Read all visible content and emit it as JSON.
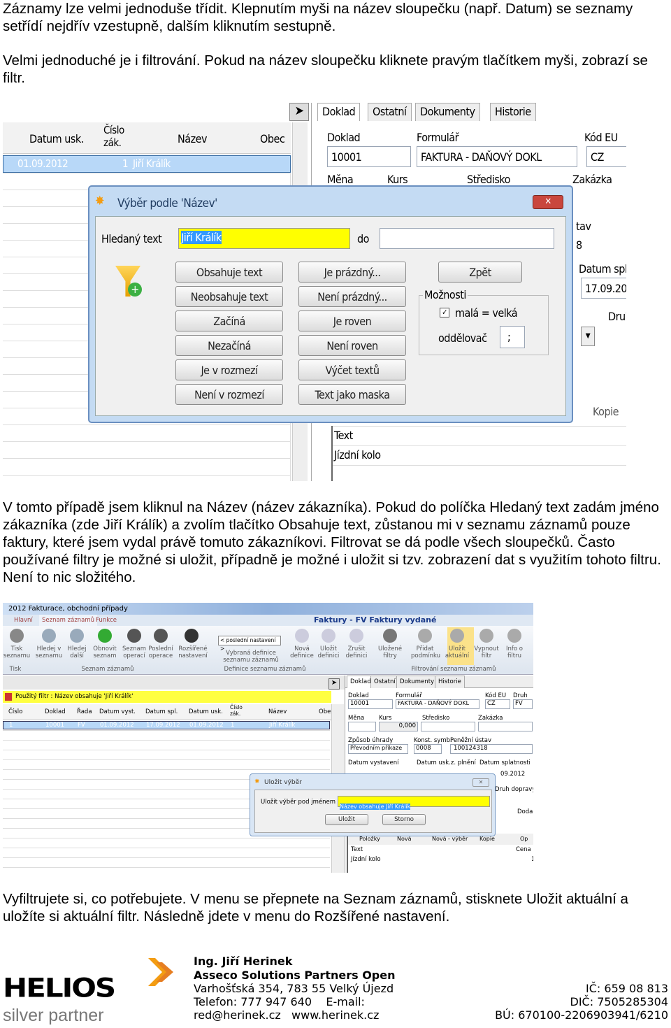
{
  "paragraphs": {
    "p1": "Záznamy lze velmi jednoduše třídit. Klepnutím myši na název sloupečku (např. Datum) se seznamy setřídí nejdřív vzestupně, dalším kliknutím sestupně.",
    "p2": "Velmi jednoduché je i filtrování. Pokud na název sloupečku kliknete pravým tlačítkem myši, zobrazí se filtr.",
    "p3": "V tomto případě jsem kliknul na Název (název zákazníka). Pokud do políčka Hledaný text zadám jméno zákazníka (zde Jiří Králík) a zvolím tlačítko Obsahuje text, zůstanou mi v seznamu záznamů pouze faktury, které jsem vydal právě tomuto zákazníkovi. Filtrovat se dá podle všech sloupečků. Často používané filtry je možné si uložit, případně je možné i uložit si tzv. zobrazení dat s využitím tohoto filtru. Není to nic složitého.",
    "p4": "Vyfiltrujete si, co potřebujete. V menu se přepnete na Seznam záznamů, stisknete Uložit aktuální a uložíte si aktuální filtr. Následně jdete v menu do Rozšířené nastavení."
  },
  "shot1": {
    "columns": [
      "Datum usk.",
      "Číslo zák.",
      "Název",
      "Obec"
    ],
    "row": [
      "01.09.2012",
      "1",
      "Jiří Králík"
    ],
    "tabs": [
      "Doklad",
      "Ostatní",
      "Dokumenty",
      "Historie"
    ],
    "fields": {
      "doklad_label": "Doklad",
      "doklad_value": "10001",
      "formular_label": "Formulář",
      "formular_value": "FAKTURA - DAŇOVÝ DOKL",
      "kod_eu_label": "Kód EU",
      "kod_eu_value": "CZ",
      "mena": "Měna",
      "kurs": "Kurs",
      "stredisko": "Středisko",
      "zakazka": "Zakázka",
      "tav": "tav",
      "eight": "8",
      "datum_spl": "Datum spl",
      "datum_spl_value": "17.09.20",
      "druh": "Druh",
      "kopie": "Kopie",
      "text_col": "Text",
      "item": "Jízdní kolo"
    },
    "dialog": {
      "title": "Výběr podle 'Název'",
      "search_label": "Hledaný text",
      "search_value": "Jiří Králík",
      "to_label": "do",
      "buttons_col1": [
        "Obsahuje text",
        "Neobsahuje text",
        "Začíná",
        "Nezačíná",
        "Je v rozmezí",
        "Není v rozmezí"
      ],
      "buttons_col2": [
        "Je prázdný...",
        "Není prázdný...",
        "Je roven",
        "Není roven",
        "Výčet textů",
        "Text jako maska"
      ],
      "back": "Zpět",
      "options_label": "Možnosti",
      "case_label": "malá = velká",
      "case_checked": true,
      "separator_label": "oddělovač",
      "separator_value": ";"
    }
  },
  "shot2": {
    "window_title": "2012 Fakturace, obchodní případy",
    "ribbon_tabs": [
      "Hlavní",
      "Seznam záznamů",
      "Funkce"
    ],
    "heading": "Faktury - FV Faktury vydané",
    "ribbon_buttons": [
      {
        "label": "Tisk seznamu",
        "group": "Tisk"
      },
      {
        "label": "Hledej v seznamu"
      },
      {
        "label": "Hledej další"
      },
      {
        "label": "Obnovit seznam"
      },
      {
        "label": "Seznam operací"
      },
      {
        "label": "Poslední operace"
      },
      {
        "label": "Rozšířené nastavení"
      },
      {
        "label": "Nová definice"
      },
      {
        "label": "Uložit definici"
      },
      {
        "label": "Zrušit definici"
      },
      {
        "label": "Uložené filtry"
      },
      {
        "label": "Přidat podmínku"
      },
      {
        "label": "Uložit aktuální"
      },
      {
        "label": "Vypnout filtr"
      },
      {
        "label": "Info o filtru"
      }
    ],
    "groups": [
      "Tisk",
      "Seznam záznamů",
      "Definice seznamu záznamů",
      "Filtrování seznamu záznamů"
    ],
    "definition_select": "< poslední nastavení >",
    "definition_caption": "Vybraná definice seznamu záznamů",
    "filter_bar": "Použitý filtr : Název obsahuje 'Jiří Králík'",
    "columns": [
      "Číslo",
      "Doklad",
      "Řada",
      "Datum vyst.",
      "Datum spl.",
      "Datum usk.",
      "Číslo zák.",
      "Název",
      "Obec"
    ],
    "row": [
      "1",
      "10001",
      "FV",
      "01.09.2012",
      "17.09.2012",
      "01.09.2012",
      "1",
      "Jiří Králík",
      ""
    ],
    "tabs": [
      "Doklad",
      "Ostatní",
      "Dokumenty",
      "Historie"
    ],
    "fields": {
      "doklad": "Doklad",
      "doklad_value": "10001",
      "formular": "Formulář",
      "formular_value": "FAKTURA - DAŇOVÝ DOKL",
      "kod_eu": "Kód EU",
      "kod_eu_value": "CZ",
      "druh": "Druh",
      "druh_value": "FV",
      "mena": "Měna",
      "kurs": "Kurs",
      "kurs_value": "0,000",
      "stredisko": "Středisko",
      "zakazka": "Zakázka",
      "zpusob": "Způsob úhrady",
      "zpusob_value": "Převodním příkaze",
      "konst": "Konst. symb.",
      "konst_value": "0008",
      "ustav": "Peněžní ústav",
      "ustav_value": "100124318",
      "datum_vyst": "Datum vystavení",
      "datum_usk": "Datum usk.z. plnění",
      "datum_spl": "Datum splatnosti",
      "datum_spl_value": "09.2012",
      "druh_dopravy": "Druh dopravy",
      "dodac": "Dodac"
    },
    "toolbar": [
      "Položky",
      "Nová",
      "Nová - výběr",
      "Kopie",
      "Op"
    ],
    "items_header": [
      "Text",
      "Cena"
    ],
    "item": [
      "Jízdní kolo",
      "1"
    ],
    "dialog": {
      "title": "Uložit výběr",
      "label": "Uložit výběr pod jménem",
      "value": "Název obsahuje Jiří Králík",
      "save": "Uložit",
      "cancel": "Storno"
    }
  },
  "footer": {
    "logo": "HELIOS",
    "logo_sub": "silver partner",
    "name": "Ing. Jiří Herinek",
    "company": "Asseco Solutions Partners Open",
    "address": "Varhošťská 354, 783 55  Velký Újezd",
    "phone": "Telefon: 777 947 640    E-mail:",
    "web": "red@herinek.cz   www.herinek.cz",
    "ic": "IČ: 659 08 813",
    "dic": "DIČ: 7505285304",
    "bu": "BÚ: 670100-2206903941/6210",
    "accent": "#f39c12"
  }
}
